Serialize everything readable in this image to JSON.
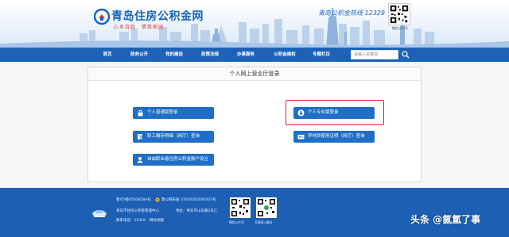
{
  "header": {
    "site_title": "青岛住房公积金网",
    "slogan": "心系百姓　情筑家园",
    "hotline_label": "青岛公积金热线 12329",
    "qr_label": "微信公众号"
  },
  "nav": {
    "items": [
      "首页",
      "政务公开",
      "党的建设",
      "政策法规",
      "办事服务",
      "公积金维权",
      "专题栏目"
    ],
    "search_placeholder": "请输入关键词"
  },
  "panel": {
    "title": "个人网上营业厅登录",
    "buttons": {
      "normal_login": "个人普通版登录",
      "pro_login": "个人专业版登录",
      "deposit_query": "职工缴存明细（网厅）查询",
      "offsite_certificate": "异地贷使用证明（网厅）查询",
      "freelancer_account": "自由职业者住房公积金账户设立"
    }
  },
  "footer": {
    "icp": "鲁ICP备05036584号",
    "police_record": "鲁公网安备 37020202000503号",
    "organizer": "青岛市住房公积金管理中心",
    "address": "地址：青岛市山东路2号乙",
    "contact": "联系电话：12329",
    "sitemap": "网站地图",
    "qr_labels": [
      "微信公众号",
      "互联网+服务"
    ]
  },
  "watermark": "头条 @氤氲了事",
  "colors": {
    "brand_blue": "#1e62b6",
    "button_blue": "#1f6ec7",
    "highlight_red": "#e02020",
    "footer_blue": "#1c5fb3"
  }
}
